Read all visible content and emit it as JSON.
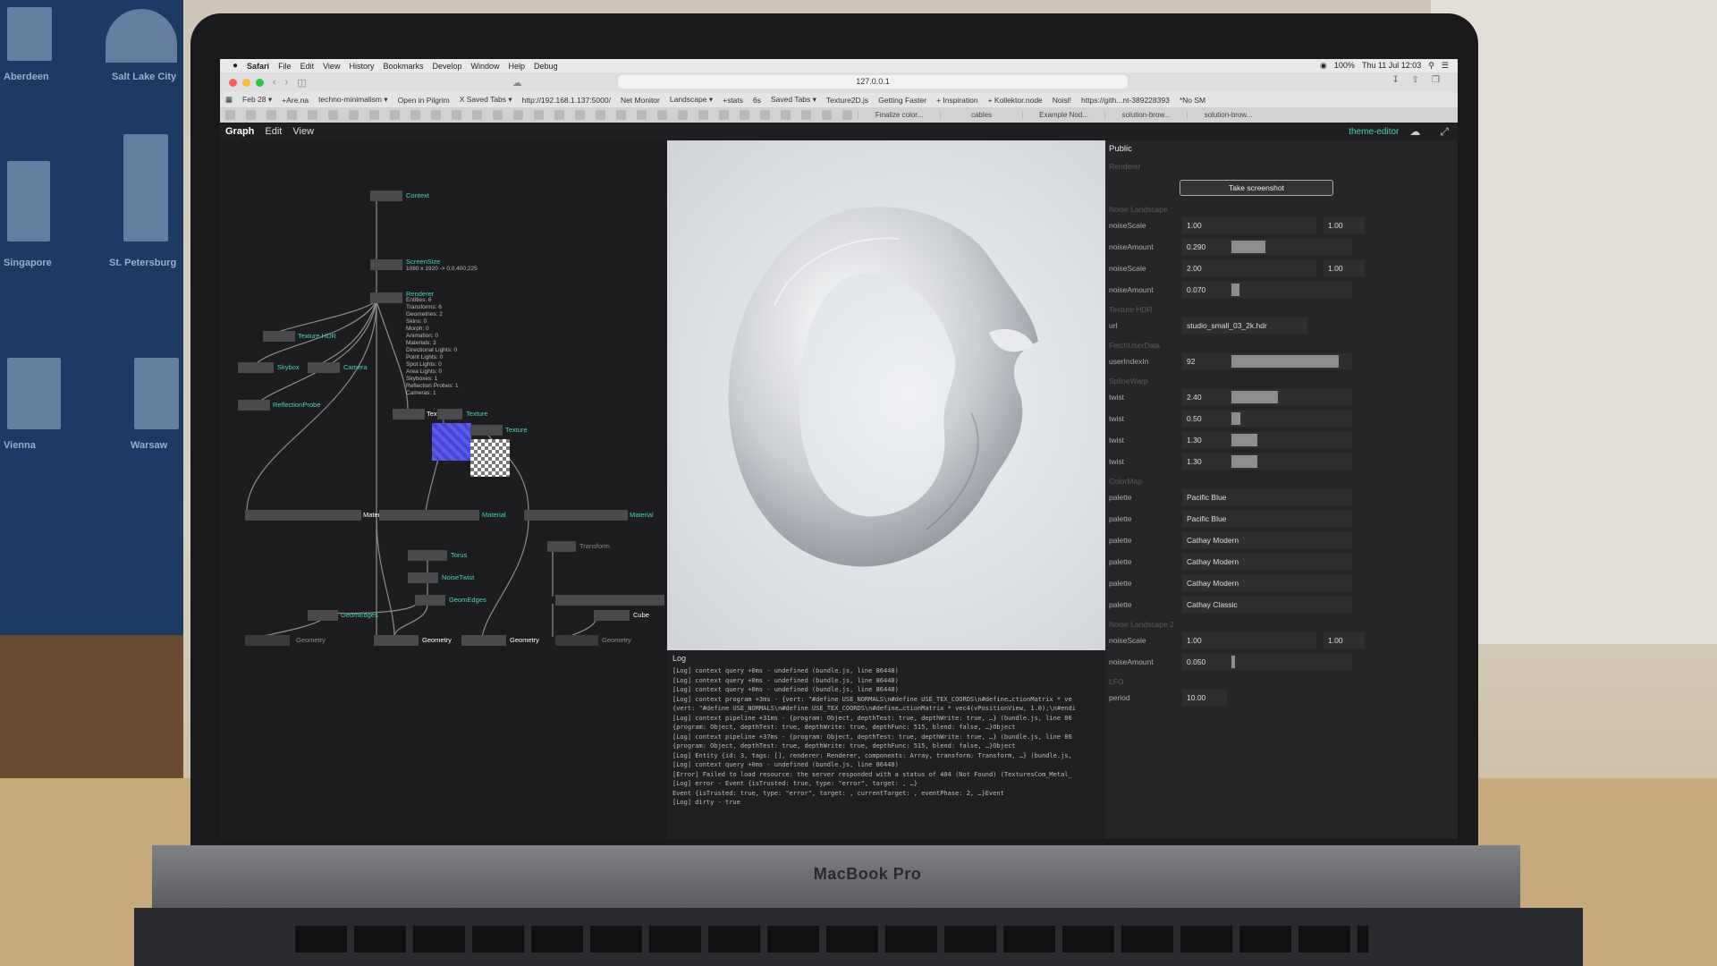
{
  "background": {
    "poster_cities": [
      "Aberdeen",
      "Salt Lake City",
      "Singapore",
      "St. Petersburg",
      "Vienna",
      "Warsaw"
    ]
  },
  "laptop": {
    "brand": "MacBook Pro"
  },
  "menubar": {
    "apple": "",
    "items": [
      "Safari",
      "File",
      "Edit",
      "View",
      "History",
      "Bookmarks",
      "Develop",
      "Window",
      "Help",
      "Debug"
    ],
    "battery": "100%",
    "clock": "Thu 11 Jul 12:03"
  },
  "toolbar": {
    "url": "127.0.0.1"
  },
  "bookmarks": [
    "Feb 28 ▾",
    "+Are.na",
    "techno-minimalism ▾",
    "Open in Pilgrim",
    "X Saved Tabs ▾",
    "http://192.168.1.137:5000/",
    "Net Monitor",
    "Landscape ▾",
    "+stats",
    "6s",
    "Saved Tabs ▾",
    "Texture2D.js",
    "Getting Faster",
    "+ Inspiration",
    "+ Kollektor.node",
    "Noisl!",
    "https://gith...nt-389228393",
    "*No SM"
  ],
  "tabs": [
    "Finalize color...",
    "cables",
    "Example Nod...",
    "solution-brow...",
    "solution-brow..."
  ],
  "appbar": {
    "menu": [
      "Graph",
      "Edit",
      "View"
    ],
    "theme": "theme-editor"
  },
  "graph": {
    "nodes": {
      "context": "Context",
      "screensize": "ScreenSize",
      "screensize_info": "1080 x 1920 -> 0,0,400,225",
      "renderer": "Renderer",
      "renderer_info": "Entities: 6\nTransforms: 6\nGeometries: 2\nSkins: 0\nMorph: 0\nAnimation: 0\nMaterials: 3\nDirectional Lights: 0\nPoint Lights: 0\nSpot Lights: 0\nArea Lights: 0\nSkyboxes: 1\nReflection Probes: 1\nCameras: 1",
      "texture_hdr": "Texture HDR",
      "skybox": "Skybox",
      "camera": "Camera",
      "reflection_probe": "ReflectionProbe",
      "texture_a": "Texture",
      "texture_b": "Texture",
      "texture_c": "Texture",
      "material_a": "Material",
      "material_b": "Material",
      "material_c": "Material",
      "torus": "Torus",
      "noisetwist": "NoiseTwist",
      "geomedges_a": "GeomEdges",
      "geomedges_b": "GeomEdges",
      "transform": "Transform",
      "cube": "Cube",
      "geometry_a": "Geometry",
      "geometry_b": "Geometry",
      "geometry_c": "Geometry",
      "geometry_d": "Geometry"
    }
  },
  "log": {
    "title": "Log",
    "lines": [
      "[Log] context query +0ms - undefined (bundle.js, line 86448)",
      "[Log] context query +0ms - undefined (bundle.js, line 86448)",
      "[Log] context query +0ms - undefined (bundle.js, line 86448)",
      "[Log] context program +3ms - {vert: \"#define USE_NORMALS\\n#define USE_TEX_COORDS\\n#define…ctionMatrix * ve",
      "{vert: \"#define USE_NORMALS\\n#define USE_TEX_COORDS\\n#define…ctionMatrix * vec4(vPositionView, 1.0);\\n#endi",
      "[Log] context pipeline +31ms - {program: Object, depthTest: true, depthWrite: true, …} (bundle.js, line 86",
      "{program: Object, depthTest: true, depthWrite: true, depthFunc: 515, blend: false, …}Object",
      "[Log] context pipeline +37ms - {program: Object, depthTest: true, depthWrite: true, …} (bundle.js, line 86",
      "{program: Object, depthTest: true, depthWrite: true, depthFunc: 515, blend: false, …}Object",
      "[Log] Entity {id: 3, tags: [], renderer: Renderer, components: Array, transform: Transform, …} (bundle.js,",
      "[Log] context query +0ms - undefined (bundle.js, line 86448)",
      "[Error] Failed to load resource: the server responded with a status of 404 (Not Found) (TexturesCom_Metal_",
      "[Log] error - Event {isTrusted: true, type: \"error\", target: , …}",
      "Event {isTrusted: true, type: \"error\", target: , currentTarget: , eventPhase: 2, …}Event",
      "[Log] dirty - true"
    ]
  },
  "panel": {
    "title": "Public",
    "sections": {
      "renderer": "Renderer",
      "noise": "Noise Landscape",
      "texhdr": "Texture HDR",
      "fetch": "FetchUserData",
      "spline": "SplineWarp",
      "colormap": "ColorMap",
      "noise2": "Noise Landscape 2",
      "lfo": "LFO"
    },
    "screenshot_button": "Take screenshot",
    "noise": [
      {
        "key": "noiseScale",
        "value": "1.00",
        "max": "1.00"
      },
      {
        "key": "noiseAmount",
        "value": "0.290",
        "fill": 0.29
      },
      {
        "key": "noiseScale",
        "value": "2.00",
        "max": "1.00"
      },
      {
        "key": "noiseAmount",
        "value": "0.070",
        "fill": 0.07
      }
    ],
    "url": {
      "key": "url",
      "value": "studio_small_03_2k.hdr"
    },
    "userIndex": {
      "key": "userIndexIn",
      "value": "92",
      "fill": 0.92
    },
    "twists": [
      {
        "key": "twist",
        "value": "2.40",
        "fill": 0.4
      },
      {
        "key": "twist",
        "value": "0.50",
        "fill": 0.08
      },
      {
        "key": "twist",
        "value": "1.30",
        "fill": 0.22
      },
      {
        "key": "twist",
        "value": "1.30",
        "fill": 0.22
      }
    ],
    "palettes": [
      {
        "key": "palette",
        "value": "Pacific Blue"
      },
      {
        "key": "palette",
        "value": "Pacific Blue"
      },
      {
        "key": "palette",
        "value": "Cathay Modern"
      },
      {
        "key": "palette",
        "value": "Cathay Modern"
      },
      {
        "key": "palette",
        "value": "Cathay Modern"
      },
      {
        "key": "palette",
        "value": "Cathay Classic"
      }
    ],
    "noise2": [
      {
        "key": "noiseScale",
        "value": "1.00",
        "max": "1.00"
      },
      {
        "key": "noiseAmount",
        "value": "0.050",
        "fill": 0.03
      }
    ],
    "lfo": {
      "key": "period",
      "value": "10.00"
    }
  },
  "colors": {
    "accent": "#3fd9b4",
    "panel_bg": "#262628",
    "graph_bg": "#1d1d1f"
  }
}
